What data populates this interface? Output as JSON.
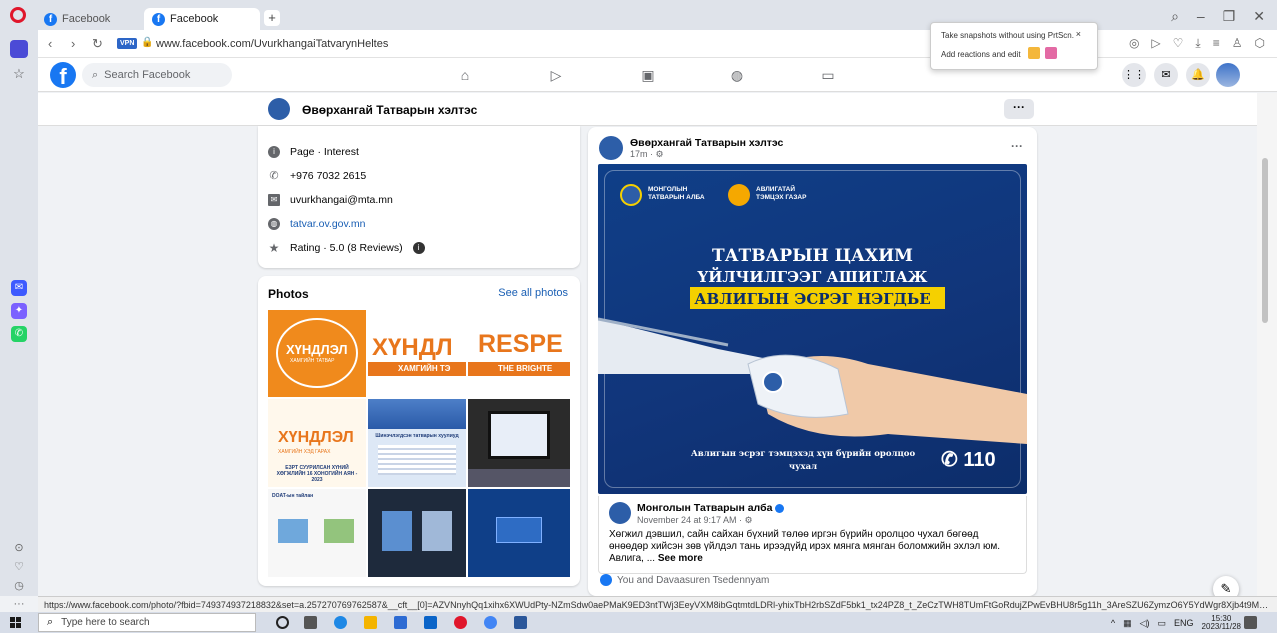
{
  "browser": {
    "tabs": [
      {
        "label": "Facebook",
        "active": false
      },
      {
        "label": "Facebook",
        "active": true
      }
    ],
    "url": "www.facebook.com/UvurkhangaiTatvarynHeltes",
    "vpn_badge": "VPN",
    "status_url": "https://www.facebook.com/photo/?fbid=749374937218832&set=a.257270769762587&__cft__[0]=AZVNnyhQq1xihx6XWUdPty-NZmSdw0aePMaK9ED3ntTWj3EeyVXM8ibGqtmtdLDRl-yhixTbH2rbSZdF5bk1_tx24PZ8_t_ZeCzTWH8TUmFtGoRdujZPwEvBHU8r5g11h_3AreSZU6ZymzO6Y5YdWgr8Xjb4t9MWM1Ue6A4CZlsynMpw..."
  },
  "snapshot_popup": {
    "line1": "Take snapshots without using PrtScn.",
    "close": "×",
    "line2": "Add reactions and edit"
  },
  "facebook": {
    "search_placeholder": "Search Facebook",
    "page_name": "Өвөрхангай Татварын хэлтэс",
    "more_label": "···"
  },
  "intro": {
    "items": [
      {
        "icon": "info-icon",
        "text": "Page · Interest"
      },
      {
        "icon": "phone-icon",
        "text": "+976 7032 2615"
      },
      {
        "icon": "mail-icon",
        "text": "uvurkhangai@mta.mn"
      },
      {
        "icon": "globe-icon",
        "text": "tatvar.ov.gov.mn"
      },
      {
        "icon": "star-icon",
        "text": "Rating · 5.0 (8 Reviews)"
      }
    ]
  },
  "photos": {
    "title": "Photos",
    "see_all": "See all photos",
    "tile1_text": "ХҮНДЛЭЛ",
    "tile1_sub": "ХАМГИЙН ТАТВАР",
    "tile2_text": "ХҮНДЛ",
    "tile2_sub": "ХАМГИЙН ТЭ",
    "tile3_text": "RESPE",
    "tile3_sub": "THE BRIGHTE",
    "tile4_text": "ХҮНДЛЭЛ",
    "tile4_sub": "ХАМГИЙН ХЭД ГАРАХ",
    "tile4_foot": "ЕЗРТ СУУРИЛСАН ХҮНИЙ ХӨГЖЛИЙН 16 ХОНОГИЙН АЯН - 2023",
    "tile5_title": "Шинэчлэгдсэн татварын хуулиуд",
    "tile7_title": "DOAT-ын тайлан"
  },
  "post": {
    "author": "Өвөрхангай Татварын хэлтэс",
    "time": "17m · ⚙",
    "more": "···",
    "banner": {
      "org1": "МОНГОЛЫН\nТАТВАРЫН АЛБА",
      "org2": "АВЛИГАТАЙ\nТЭМЦЭХ ГАЗАР",
      "line1": "ТАТВАРЫН ЦАХИМ",
      "line2": "ҮЙЛЧИЛГЭЭГ АШИГЛАЖ",
      "line3": "АВЛИГЫН ЭСРЭГ НЭГДЬЕ",
      "bottom": "Авлигын эсрэг тэмцэхэд хүн бүрийн оролцоо чухал",
      "phone": "✆ 110"
    },
    "shared": {
      "author": "Монголын Татварын алба",
      "time": "November 24 at 9:17 AM · ⚙",
      "text": "Хөгжил дэвшил, сайн сайхан бүхний төлөө иргэн бүрийн оролцоо чухал бөгөөд өнөөдөр хийсэн зөв үйлдэл тань ирээдүйд ирэх мянга мянган боломжийн эхлэл юм. Авлига, ...",
      "see_more": "See more"
    },
    "reactions": "You and Davaasuren Tsedennyam"
  },
  "taskbar": {
    "search_placeholder": "Type here to search",
    "lang": "ENG",
    "time": "15:30",
    "date": "2023/11/28"
  },
  "colors": {
    "facebook_blue": "#1877f2",
    "banner_navy": "#0f3f88",
    "highlight_yellow": "#f5d000",
    "orange_tile": "#f08a1c"
  }
}
